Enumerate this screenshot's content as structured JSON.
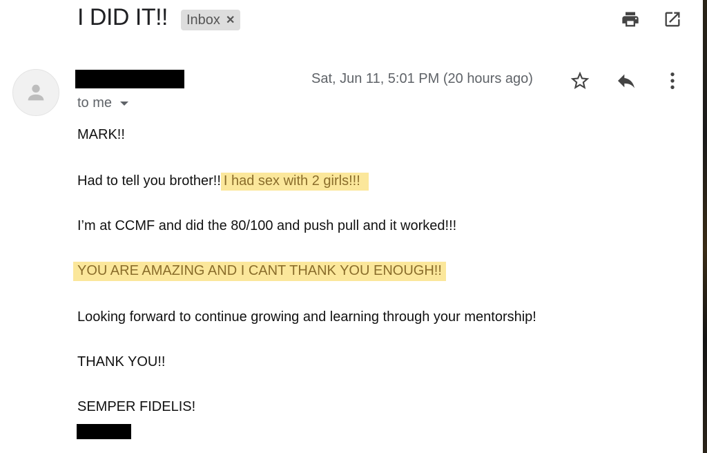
{
  "email": {
    "subject": "I DID IT!!",
    "label": "Inbox",
    "date": "Sat, Jun 11, 5:01 PM (20 hours ago)",
    "recipient": "to me"
  },
  "body": {
    "greeting": "MARK!!",
    "line1_plain": "Had to tell you brother!!",
    "line1_highlight": "I had sex with 2 girls!!!",
    "line2": "I’m at CCMF and did the 80/100 and push pull and it worked!!!",
    "line3_highlight": "YOU ARE AMAZING AND I CANT THANK YOU ENOUGH!!",
    "line4": "Looking forward to continue growing and learning through your mentorship!",
    "line5": "THANK YOU!!",
    "line6": "SEMPER FIDELIS!"
  },
  "icons": {
    "print": "print-icon",
    "open_new_window": "open-in-new-window-icon",
    "star": "star-icon",
    "reply": "reply-icon",
    "more": "more-vertical-icon",
    "avatar": "default-avatar-icon"
  },
  "colors": {
    "highlight_bg": "#fbe79b",
    "highlight_text": "#8a6d2b",
    "label_chip_bg": "#dddddd",
    "meta_text": "#5f6368"
  }
}
